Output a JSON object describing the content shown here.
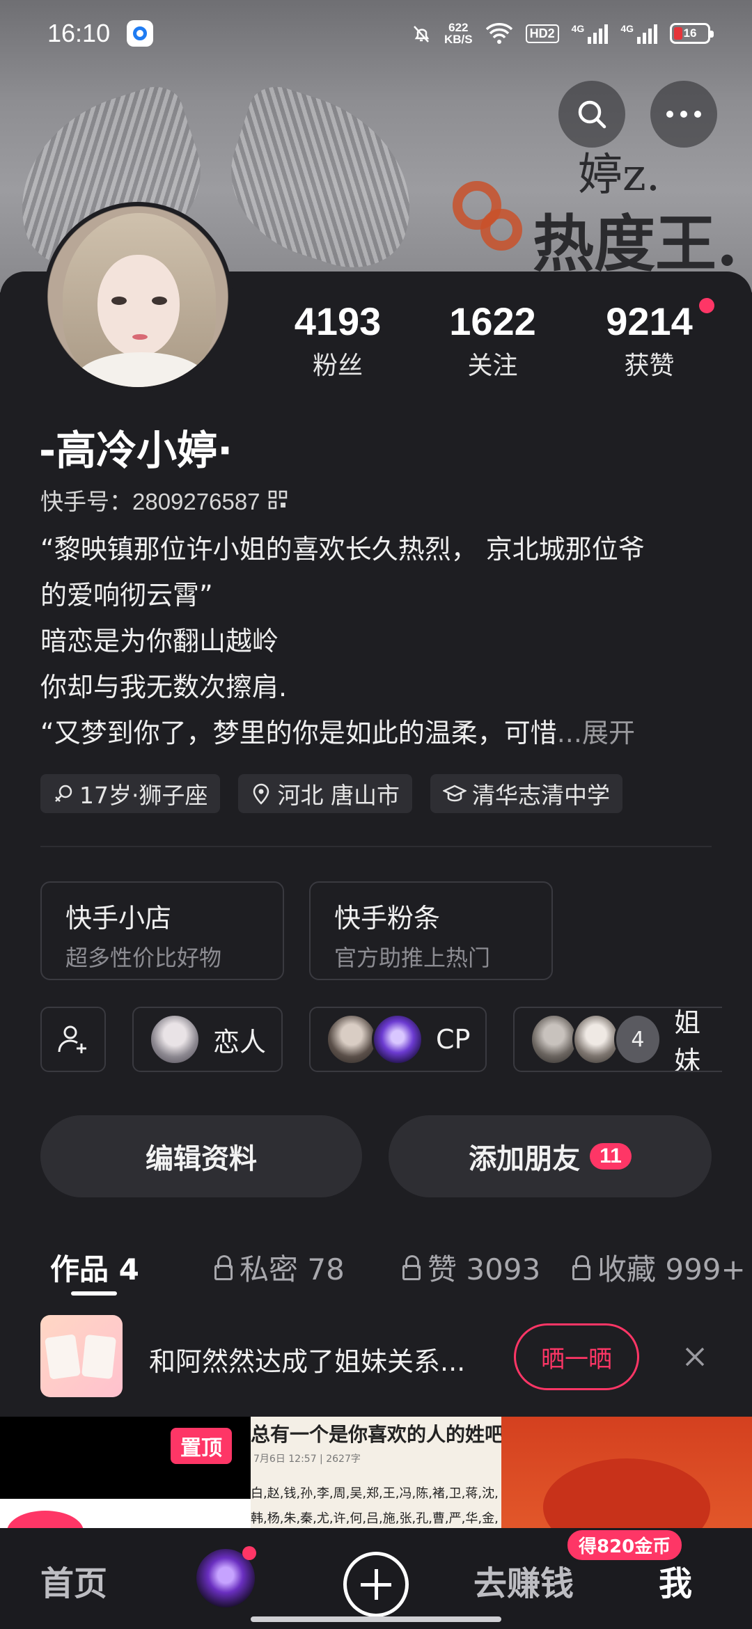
{
  "status_bar": {
    "time": "16:10",
    "net_speed_top": "622",
    "net_speed_bottom": "KB/S",
    "hd": "HD2",
    "sim1": "4G",
    "sim2": "4G",
    "battery": "16",
    "battery_color": "#e5343a"
  },
  "header": {
    "bg_text_line1": "婷z.",
    "bg_text_line2": "热度王.",
    "search_icon": "search-icon",
    "more_icon": "more-horizontal-icon"
  },
  "profile": {
    "stats": [
      {
        "value": "4193",
        "label": "粉丝"
      },
      {
        "value": "1622",
        "label": "关注"
      },
      {
        "value": "9214",
        "label": "获赞"
      }
    ],
    "name": "-高冷小婷·",
    "uid": "快手号：2809276587",
    "bio": [
      "“黎映镇那位许小姐的喜欢长久热烈， 京北城那位爷",
      "的爱响彻云霄”",
      "暗恋是为你翻山越岭",
      "你却与我无数次擦肩.",
      "“又梦到你了，梦里的你是如此的温柔，可惜"
    ],
    "bio_ellipsis": "...",
    "bio_expand": "展开",
    "tags": [
      "17岁·狮子座",
      "河北 唐山市",
      "清华志清中学"
    ]
  },
  "shops": [
    {
      "title": "快手小店",
      "subtitle": "超多性价比好物"
    },
    {
      "title": "快手粉条",
      "subtitle": "官方助推上热门"
    }
  ],
  "relations": [
    {
      "label": "恋人"
    },
    {
      "label": "CP"
    },
    {
      "label": "姐妹",
      "count": "4"
    }
  ],
  "actions": {
    "edit": "编辑资料",
    "add_friend": "添加朋友",
    "add_friend_badge": "11"
  },
  "tabs": [
    {
      "label": "作品 4",
      "active": true
    },
    {
      "label": "私密 78"
    },
    {
      "label": "赞 3093"
    },
    {
      "label": "收藏 999+"
    }
  ],
  "notice": {
    "text": "和阿然然达成了姐妹关系...",
    "button": "晒一晒"
  },
  "thumbs": {
    "pin_label": "置顶",
    "t2_title": "总有一个是你喜欢的人的姓吧",
    "t2_meta": "7月6日 12:57 | 2627字",
    "t2_line1": "白,赵,钱,孙,李,周,吴,郑,王,冯,陈,褚,卫,蒋,沈,",
    "t2_line2": "韩,杨,朱,秦,尤,许,何,吕,施,张,孔,曹,严,华,金,"
  },
  "bottom_nav": {
    "home": "首页",
    "earn": "去赚钱",
    "coin_badge": "得820金币",
    "me": "我"
  },
  "colors": {
    "accent": "#fe3666",
    "background": "#1e1e22",
    "button": "#2e2e33"
  }
}
